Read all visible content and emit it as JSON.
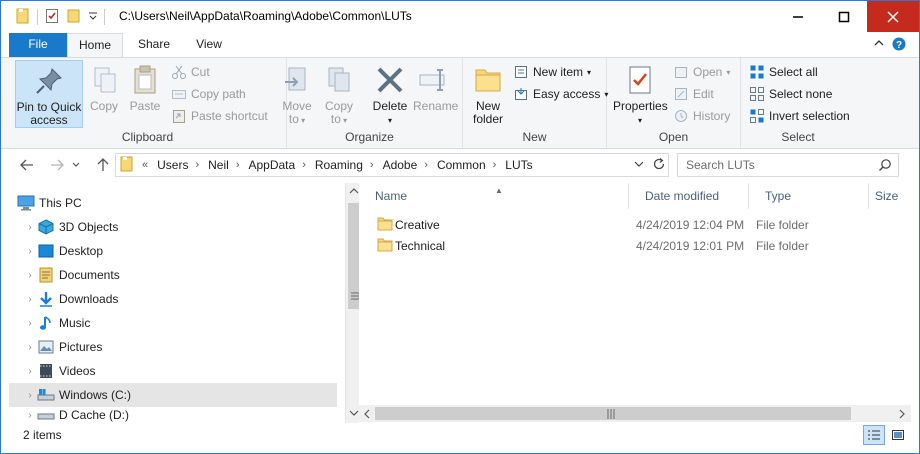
{
  "window": {
    "title": "C:\\Users\\Neil\\AppData\\Roaming\\Adobe\\Common\\LUTs",
    "minimize_label": "—",
    "maximize_label": "☐",
    "close_label": "✕"
  },
  "ribbon_tabs": {
    "file": "File",
    "home": "Home",
    "share": "Share",
    "view": "View"
  },
  "ribbon": {
    "clipboard": {
      "label": "Clipboard",
      "pin_line1": "Pin to Quick",
      "pin_line2": "access",
      "copy": "Copy",
      "paste": "Paste",
      "cut": "Cut",
      "copy_path": "Copy path",
      "paste_shortcut": "Paste shortcut"
    },
    "organize": {
      "label": "Organize",
      "move_to_line1": "Move",
      "move_to_line2": "to",
      "copy_to_line1": "Copy",
      "copy_to_line2": "to",
      "delete": "Delete",
      "rename": "Rename"
    },
    "new": {
      "label": "New",
      "new_folder_line1": "New",
      "new_folder_line2": "folder",
      "new_item": "New item",
      "easy_access": "Easy access"
    },
    "open": {
      "label": "Open",
      "properties": "Properties",
      "open": "Open",
      "edit": "Edit",
      "history": "History"
    },
    "select": {
      "label": "Select",
      "select_all": "Select all",
      "select_none": "Select none",
      "invert_selection": "Invert selection"
    }
  },
  "address": {
    "overflow": "«",
    "crumbs": [
      "Users",
      "Neil",
      "AppData",
      "Roaming",
      "Adobe",
      "Common",
      "LUTs"
    ]
  },
  "search": {
    "placeholder": "Search LUTs"
  },
  "nav_tree": [
    {
      "label": "This PC",
      "icon": "this-pc-icon",
      "level": 0
    },
    {
      "label": "3D Objects",
      "icon": "3d-objects-icon",
      "level": 1
    },
    {
      "label": "Desktop",
      "icon": "desktop-icon",
      "level": 1
    },
    {
      "label": "Documents",
      "icon": "documents-icon",
      "level": 1
    },
    {
      "label": "Downloads",
      "icon": "downloads-icon",
      "level": 1
    },
    {
      "label": "Music",
      "icon": "music-icon",
      "level": 1
    },
    {
      "label": "Pictures",
      "icon": "pictures-icon",
      "level": 1
    },
    {
      "label": "Videos",
      "icon": "videos-icon",
      "level": 1
    },
    {
      "label": "Windows (C:)",
      "icon": "drive-c-icon",
      "level": 1,
      "selected": true
    },
    {
      "label": "D Cache (D:)",
      "icon": "drive-d-icon",
      "level": 1
    }
  ],
  "columns": {
    "name": "Name",
    "date_modified": "Date modified",
    "type": "Type",
    "size": "Size"
  },
  "files": [
    {
      "name": "Creative",
      "date_modified": "4/24/2019 12:04 PM",
      "type": "File folder"
    },
    {
      "name": "Technical",
      "date_modified": "4/24/2019 12:01 PM",
      "type": "File folder"
    }
  ],
  "status": {
    "item_count": "2 items"
  },
  "colors": {
    "accent": "#1979ca",
    "close": "#c42b1c",
    "folder": "#f8d775",
    "selection": "#cce4f7"
  }
}
